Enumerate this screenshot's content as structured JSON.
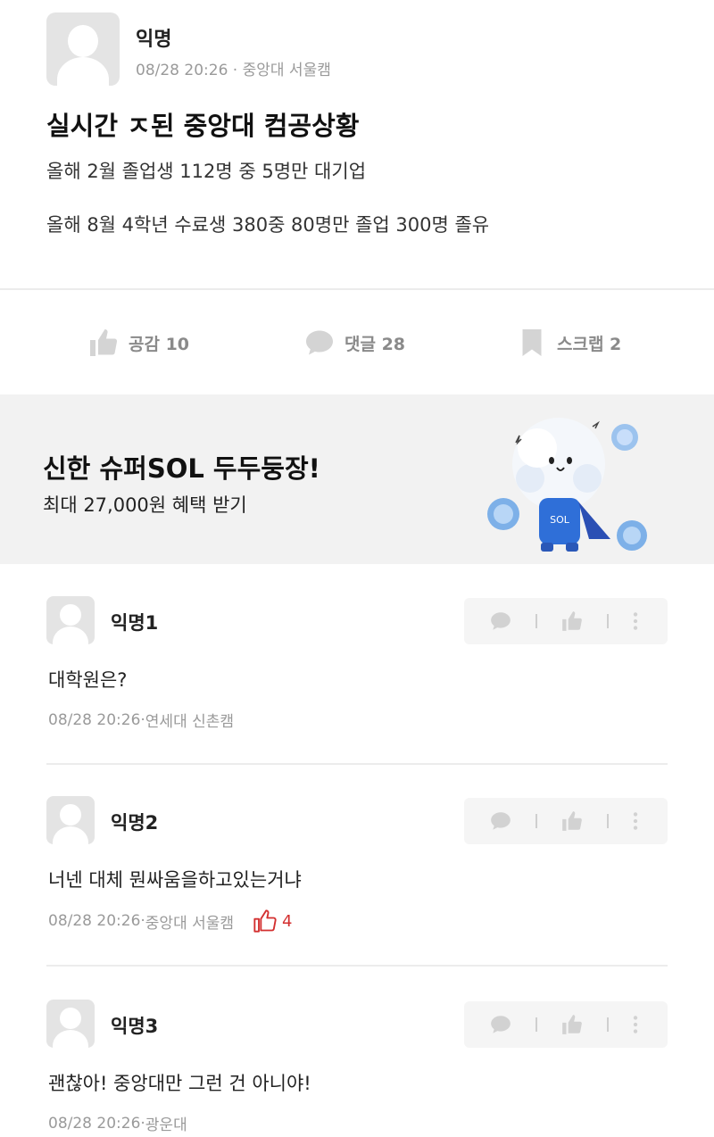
{
  "post": {
    "author": "익명",
    "time": "08/28 20:26",
    "campus": "중앙대 서울캠",
    "title": "실시간 ㅈ된 중앙대 컴공상황",
    "body": [
      "올해 2월 졸업생 112명 중 5명만 대기업",
      "올해 8월 4학년 수료생 380중 80명만 졸업 300명 졸유"
    ]
  },
  "actions": {
    "like": "공감 10",
    "comment": "댓글 28",
    "scrap": "스크랩 2"
  },
  "ad": {
    "title": "신한 슈퍼SOL 두두둥장!",
    "subtitle": "최대 27,000원 혜택 받기",
    "mascot_label": "SOL"
  },
  "comments": [
    {
      "author": "익명1",
      "text": "대학원은?",
      "time": "08/28 20:26",
      "campus": "연세대 신촌캠",
      "likes": ""
    },
    {
      "author": "익명2",
      "text": "너넨 대체 뭔싸움을하고있는거냐",
      "time": "08/28 20:26",
      "campus": "중앙대 서울캠",
      "likes": "4"
    },
    {
      "author": "익명3",
      "text": "괜찮아! 중앙대만 그런 건 아니야!",
      "time": "08/28 20:26",
      "campus": "광운대",
      "likes": ""
    }
  ],
  "separator": " · ",
  "colors": {
    "like_accent": "#d32f2f",
    "meta_gray": "#9a9a9a",
    "ad_background": "#f2f2f2",
    "mascot_blue": "#2f6fd8"
  },
  "icons": {
    "like": "thumb-up-icon",
    "comment": "speech-bubble-icon",
    "scrap": "bookmark-icon",
    "more": "more-vertical-icon"
  }
}
